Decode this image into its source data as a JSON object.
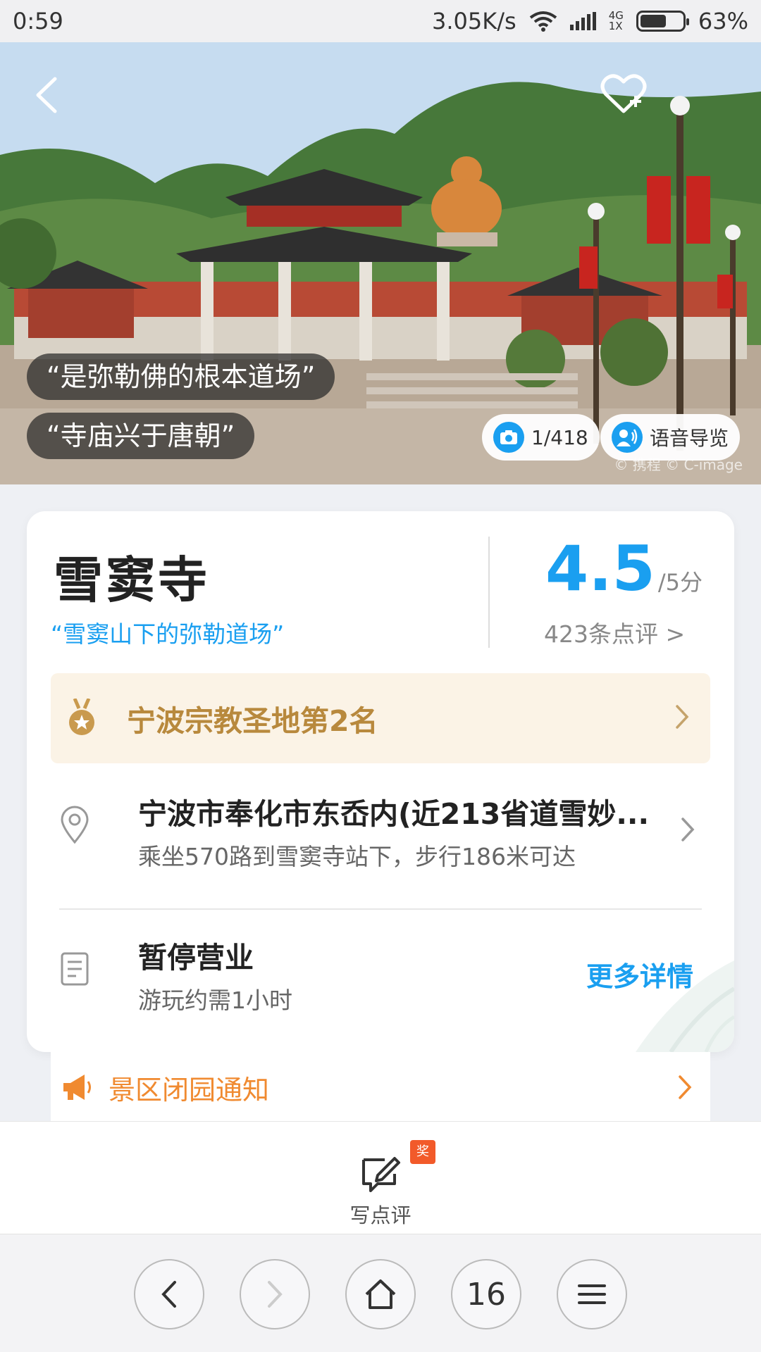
{
  "status_bar": {
    "time": "0:59",
    "net_speed": "3.05K/s",
    "net_type_top": "4G",
    "net_type_bottom": "1X",
    "battery": "63%",
    "battery_level": 0.63
  },
  "hero": {
    "quotes": [
      "“是弥勒佛的根本道场”",
      "“寺庙兴于唐朝”"
    ],
    "photo_count": "1/418",
    "audio_guide": "语音导览",
    "watermark": "© 携程 © C-image"
  },
  "info": {
    "name": "雪窦寺",
    "slogan": "“雪窦山下的弥勒道场”",
    "score": "4.5",
    "score_max": "/5分",
    "reviews": "423条点评 >"
  },
  "rank": {
    "text": "宁波宗教圣地第2名"
  },
  "address": {
    "main": "宁波市奉化市东岙内(近213省道雪妙...",
    "transit": "乘坐570路到雪窦寺站下，步行186米可达"
  },
  "hours": {
    "status": "暂停营业",
    "duration": "游玩约需1小时",
    "more": "更多详情"
  },
  "notice": {
    "text": "景区闭园通知"
  },
  "action_bar": {
    "write_review": "写点评",
    "badge": "奖"
  },
  "nav_bar": {
    "tab_count": "16"
  },
  "colors": {
    "accent": "#1a9ff0",
    "rank_gold": "#b8893d",
    "notice_orange": "#f08a30",
    "badge_red": "#f25a2a"
  },
  "icons": [
    "back-icon",
    "favorite-add-icon",
    "camera-icon",
    "audio-guide-icon",
    "medal-icon",
    "location-pin-icon",
    "document-icon",
    "megaphone-icon",
    "edit-icon",
    "chevron-right-icon",
    "home-icon",
    "menu-icon"
  ]
}
